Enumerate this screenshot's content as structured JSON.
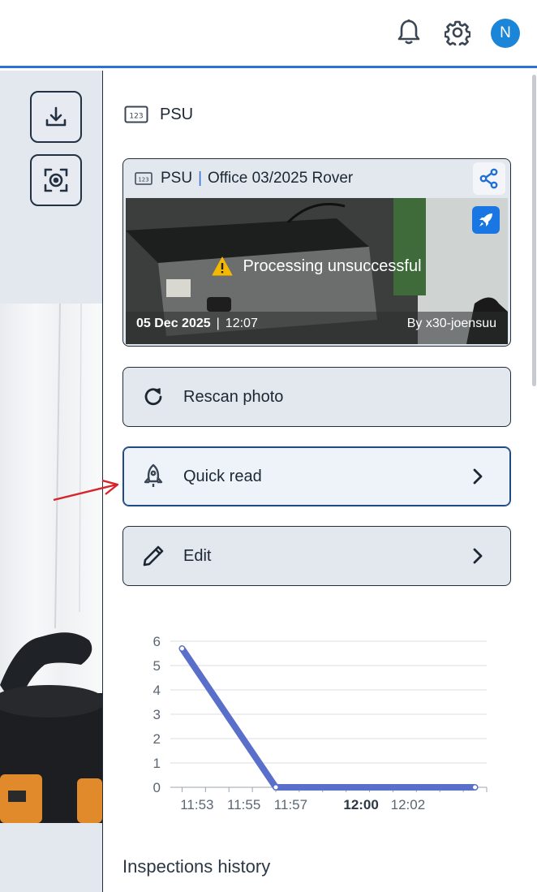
{
  "topbar": {
    "avatar_initial": "N",
    "icons": [
      "bell-icon",
      "gear-icon"
    ],
    "accent": "#2b72d6"
  },
  "breadcrumb": {
    "title": "PSU",
    "icon": "numeric-field-icon"
  },
  "card": {
    "name": "PSU",
    "separator": "|",
    "location": "Office 03/2025 Rover",
    "status": "Processing unsuccessful",
    "date": "05 Dec 2025",
    "date_sep": "|",
    "time": "12:07",
    "by_label": "By",
    "author": "x30-joensuu"
  },
  "actions": {
    "rescan": "Rescan photo",
    "quick_read": "Quick read",
    "edit": "Edit"
  },
  "chart_data": {
    "type": "line",
    "x": [
      "11:52:30",
      "11:56:30",
      "12:05"
    ],
    "values": [
      5.7,
      0,
      0
    ],
    "yticks": [
      "0",
      "1",
      "2",
      "3",
      "4",
      "5",
      "6"
    ],
    "xticks": [
      "11:53",
      "11:55",
      "11:57",
      "12:00",
      "12:02"
    ],
    "bold_tick": "12:00",
    "ylim": [
      0,
      6
    ],
    "color": "#5a6fc9",
    "grid": true
  },
  "history": {
    "title": "Inspections history"
  }
}
